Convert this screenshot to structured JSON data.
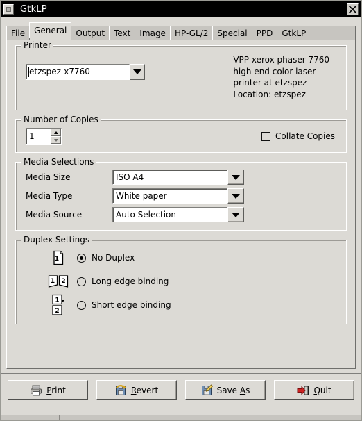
{
  "window": {
    "title": "GtkLP",
    "icon": "window-menu-icon",
    "close_icon": "close-icon"
  },
  "tabs": [
    {
      "label": "File",
      "active": false
    },
    {
      "label": "General",
      "active": true
    },
    {
      "label": "Output",
      "active": false
    },
    {
      "label": "Text",
      "active": false
    },
    {
      "label": "Image",
      "active": false
    },
    {
      "label": "HP-GL/2",
      "active": false
    },
    {
      "label": "Special",
      "active": false
    },
    {
      "label": "PPD",
      "active": false
    },
    {
      "label": "GtkLP",
      "active": false
    }
  ],
  "printer": {
    "title": "Printer",
    "selected": "etzspez-x7760",
    "description": "VPP xerox phaser 7760\nhigh end color laser\nprinter at etzspez\nLocation: etzspez"
  },
  "copies": {
    "title": "Number of Copies",
    "value": "1",
    "collate_label": "Collate Copies",
    "collate_checked": false
  },
  "media": {
    "title": "Media Selections",
    "rows": [
      {
        "label": "Media Size",
        "value": "ISO A4"
      },
      {
        "label": "Media Type",
        "value": "White paper"
      },
      {
        "label": "Media Source",
        "value": "Auto Selection"
      }
    ]
  },
  "duplex": {
    "title": "Duplex Settings",
    "options": [
      {
        "label": "No Duplex",
        "selected": true,
        "icon": "single-page-icon"
      },
      {
        "label": "Long edge binding",
        "selected": false,
        "icon": "book-spread-icon"
      },
      {
        "label": "Short edge binding",
        "selected": false,
        "icon": "stacked-pages-icon"
      }
    ]
  },
  "actions": [
    {
      "label": "Print",
      "mnemonic": "P",
      "icon": "printer-icon"
    },
    {
      "label": "Revert",
      "mnemonic": "R",
      "icon": "revert-floppy-icon"
    },
    {
      "label": "Save As",
      "mnemonic": "A",
      "icon": "save-as-floppy-icon"
    },
    {
      "label": "Quit",
      "mnemonic": "Q",
      "icon": "exit-door-icon"
    }
  ],
  "colors": {
    "window_bg": "#dcdad5",
    "titlebar_bg": "#000000",
    "titlebar_fg": "#ffffff",
    "tab_inactive": "#c7c5c0",
    "entry_bg": "#ffffff"
  }
}
